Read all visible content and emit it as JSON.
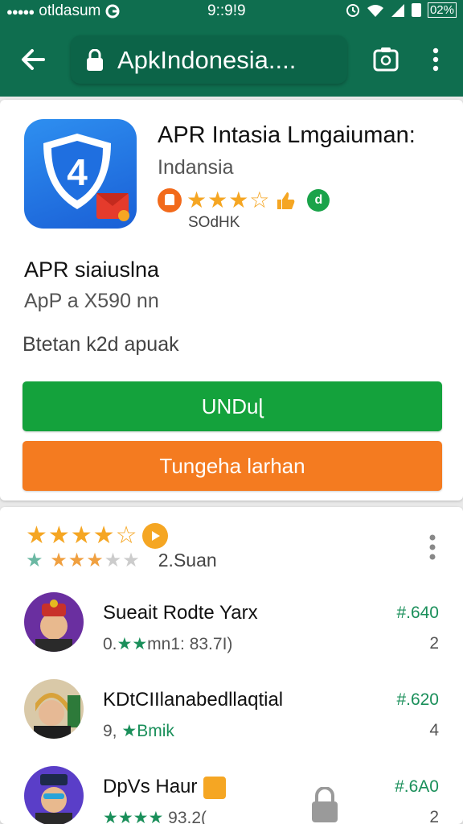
{
  "status_bar": {
    "carrier": "otldasum",
    "time": "9::9!9",
    "battery": "02%"
  },
  "header": {
    "url": "ApkIndonesia...."
  },
  "app": {
    "title": "APR Intasia Lmgaiuman:",
    "developer": "Indansia",
    "review_count": "SOdHK",
    "badge_letter": "d"
  },
  "info": {
    "heading": "APR siaiuslna",
    "size": "ApP a X590 nn",
    "note": "Btetan k2d apuak"
  },
  "buttons": {
    "install": "UNDuɭ",
    "secondary": "Tungeha larhan"
  },
  "summary": {
    "count": "2.Suan"
  },
  "reviews": [
    {
      "name": "Sueait Rodte Yarx",
      "meta_prefix": "0.",
      "meta_stars": "★★",
      "meta_suffix": "mn1: 83.7I)",
      "price": "#.640",
      "num": "2"
    },
    {
      "name": "KDtCIIlanabedllaqtial",
      "meta_prefix": "9, ",
      "meta_stars": "★",
      "meta_suffix": "Bmik",
      "price": "#.620",
      "num": "4"
    },
    {
      "name": "DpVs Haur",
      "meta_prefix": "",
      "meta_stars": "★★★★",
      "meta_suffix": "93.2(",
      "price": "#.6A0",
      "num": "2"
    }
  ],
  "colors": {
    "header_green": "#0f6e4f",
    "install_green": "#14a23c",
    "secondary_orange": "#f47b20",
    "star_gold": "#f5a623"
  }
}
